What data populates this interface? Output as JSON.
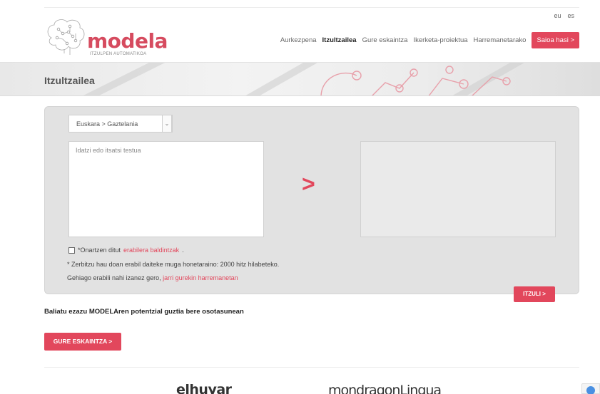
{
  "lang": {
    "eu": "eu",
    "es": "es"
  },
  "logo": {
    "word": "modela",
    "subtitle": "ITZULPEN AUTOMATIKOA"
  },
  "nav": {
    "items": [
      "Aurkezpena",
      "Itzultzailea",
      "Gure eskaintza",
      "Ikerketa-proiektua",
      "Harremanetarako"
    ],
    "active_index": 1,
    "login": "Saioa hasi >"
  },
  "banner": {
    "title": "Itzultzailea"
  },
  "translator": {
    "direction_selected": "Euskara > Gaztelania",
    "source_placeholder": "Idatzi edo itsatsi testua",
    "arrow": ">",
    "terms_prefix": "*Onartzen ditut ",
    "terms_link": "erabilera baldintzak",
    "terms_suffix": ".",
    "limit_text": "* Zerbitzu hau doan erabil daiteke muga honetaraino: 2000 hitz hilabeteko.",
    "contact_prefix": "Gehiago erabili nahi izanez gero, ",
    "contact_link": "jarri gurekin harremanetan",
    "translate_button": "ITZULI >"
  },
  "promo": {
    "text": "Baliatu ezazu MODELAren potentzial guztia bere osotasunean",
    "button": "GURE ESKAINTZA >"
  },
  "partners": [
    "elhuyar",
    "mondragonLingua"
  ],
  "colors": {
    "accent": "#e2475c",
    "panel": "#e2e2e2"
  },
  "icons": {
    "logo": "brain-circuit-icon",
    "recaptcha": "recaptcha-icon"
  }
}
